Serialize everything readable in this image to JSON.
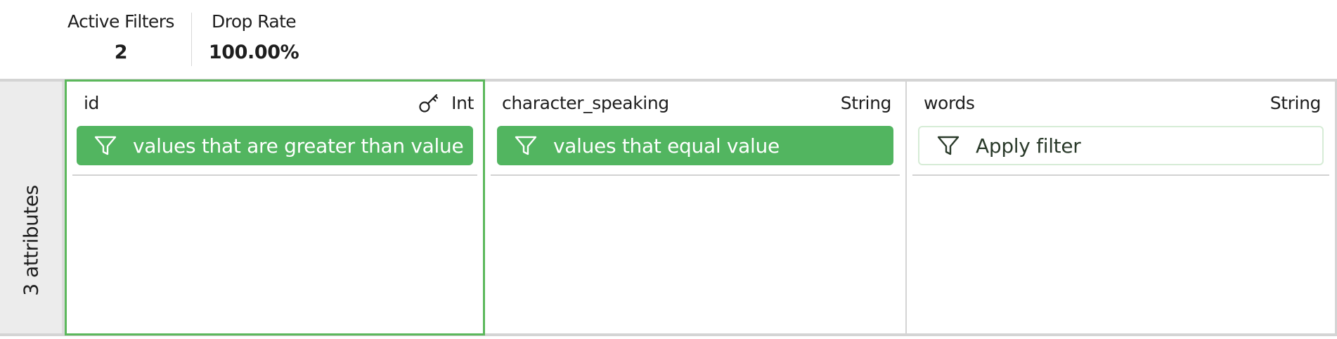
{
  "stats": {
    "active_filters_label": "Active Filters",
    "active_filters_value": "2",
    "drop_rate_label": "Drop Rate",
    "drop_rate_value": "100.00%"
  },
  "attributes": {
    "count_label": "3 attributes",
    "columns": [
      {
        "name": "id",
        "type": "Int",
        "is_key": true,
        "key_icon": "key-icon",
        "filter_icon": "filter-icon",
        "filter_active": true,
        "filter_label": "values that are greater than value"
      },
      {
        "name": "character_speaking",
        "type": "String",
        "is_key": false,
        "filter_icon": "filter-icon",
        "filter_active": true,
        "filter_label": "values that equal value"
      },
      {
        "name": "words",
        "type": "String",
        "is_key": false,
        "filter_icon": "filter-icon",
        "filter_active": false,
        "filter_label": "Apply filter"
      }
    ]
  },
  "colors": {
    "active_filter": "#52b560",
    "selected_border": "#5cb85c",
    "side_panel": "#ececec"
  }
}
